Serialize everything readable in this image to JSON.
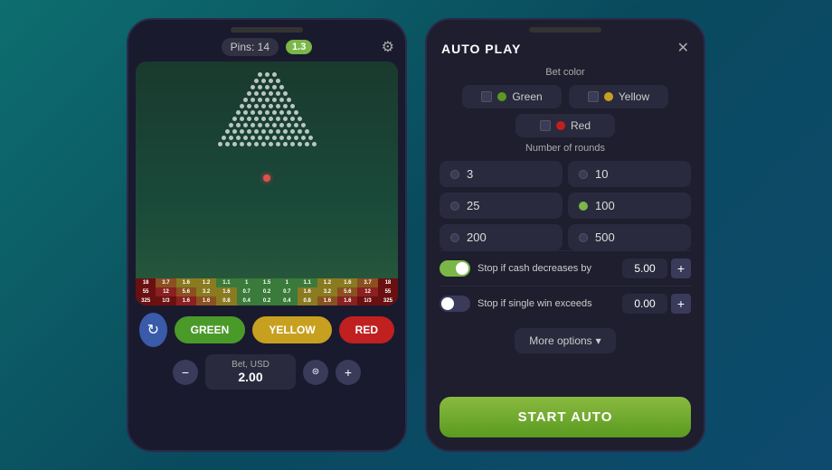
{
  "left_phone": {
    "notch": "",
    "header": {
      "pins_label": "Pins: 14",
      "multiplier": "1.3",
      "settings_icon": "⚙"
    },
    "color_buttons": {
      "refresh_icon": "↻",
      "green": "GREEN",
      "yellow": "YELLOW",
      "red": "RED"
    },
    "bet": {
      "label": "Bet, USD",
      "value": "2.00",
      "minus": "−",
      "stack_icon": "⊜",
      "plus": "+"
    },
    "score_rows": [
      [
        "18",
        "3.7",
        "1.6",
        "1.2",
        "1.1",
        "1",
        "1.5",
        "1",
        "1.1",
        "1.2",
        "1.6",
        "3.7",
        "18"
      ],
      [
        "55",
        "12",
        "5.6",
        "3.2",
        "1.6",
        "0.7",
        "0.2",
        "0.7",
        "1.6",
        "3.2",
        "5.6",
        "12",
        "55"
      ],
      [
        "325",
        "1/3",
        "1.6",
        "1.6",
        "0.8",
        "0.4",
        "0.2",
        "0.4",
        "0.8",
        "1.6",
        "1.6",
        "1/3",
        "325"
      ]
    ]
  },
  "right_panel": {
    "title": "AUTO PLAY",
    "close_icon": "✕",
    "bet_color_section": {
      "label": "Bet color",
      "options": [
        {
          "id": "green",
          "name": "Green",
          "color": "#5a9a20",
          "selected": false
        },
        {
          "id": "yellow",
          "name": "Yellow",
          "color": "#c8a020",
          "selected": false
        },
        {
          "id": "red",
          "name": "Red",
          "color": "#c02020",
          "selected": false
        }
      ]
    },
    "rounds_section": {
      "label": "Number of rounds",
      "options": [
        {
          "value": "3",
          "active": false
        },
        {
          "value": "10",
          "active": false
        },
        {
          "value": "25",
          "active": false
        },
        {
          "value": "100",
          "active": true
        },
        {
          "value": "200",
          "active": false
        },
        {
          "value": "500",
          "active": false
        }
      ]
    },
    "toggles": [
      {
        "id": "cash-decrease",
        "label": "Stop if cash decreases by",
        "enabled": true,
        "value": "5.00"
      },
      {
        "id": "single-win",
        "label": "Stop if single win exceeds",
        "enabled": false,
        "value": "0.00"
      }
    ],
    "more_options_label": "More options",
    "more_options_icon": "▾",
    "start_auto_label": "START AUTO"
  }
}
